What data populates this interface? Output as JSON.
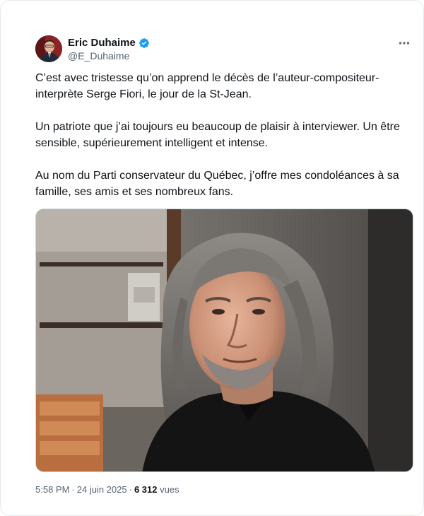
{
  "author": {
    "display_name": "Eric Duhaime",
    "handle": "@E_Duhaime",
    "verified_icon": "verified-badge-icon",
    "verified_color": "#1d9bf0"
  },
  "tweet": {
    "paragraphs": [
      "C’est avec tristesse qu’on apprend le décès de l’auteur-compositeur-interprète Serge Fiori, le jour de la St-Jean.",
      "Un patriote que j’ai toujours eu beaucoup de plaisir à interviewer. Un être sensible, supérieurement intelligent et intense.",
      "Au nom du Parti conservateur du Québec, j’offre mes condoléances à sa famille, ses amis et ses nombreux fans."
    ]
  },
  "meta": {
    "time": "5:58 PM",
    "separator": "·",
    "date": "24 juin 2025",
    "view_count": "6 312",
    "view_label": "vues"
  },
  "icons": {
    "more": "more-options-icon"
  },
  "colors": {
    "text_primary": "#0f1419",
    "text_secondary": "#536471",
    "border": "#cfd9de"
  }
}
